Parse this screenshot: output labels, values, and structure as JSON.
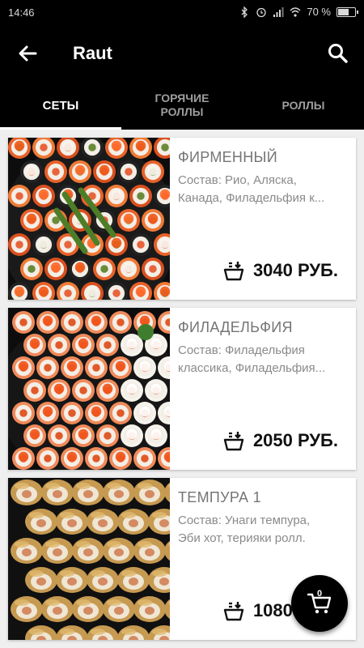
{
  "status_bar": {
    "time": "14:46",
    "battery": "70 %",
    "battery_level": 0.7,
    "icons": [
      "bluetooth-icon",
      "alarm-icon",
      "signal-icon",
      "wifi-icon",
      "battery-icon"
    ]
  },
  "toolbar": {
    "title": "Raut",
    "back_icon": "arrow-left-icon",
    "search_icon": "search-icon"
  },
  "tabs": [
    {
      "label": "СЕТЫ",
      "active": true
    },
    {
      "label": "ГОРЯЧИЕ\nРОЛЛЫ",
      "active": false
    },
    {
      "label": "РОЛЛЫ",
      "active": false
    }
  ],
  "products": [
    {
      "name": "ФИРМЕННЫЙ",
      "desc_line1": "Состав: Рио, Аляска,",
      "desc_line2": "Канада, Филадельфия к...",
      "price": "3040 РУБ."
    },
    {
      "name": "ФИЛАДЕЛЬФИЯ",
      "desc_line1": "Состав: Филадельфия",
      "desc_line2": "классика, Филадельфия...",
      "price": "2050 РУБ."
    },
    {
      "name": "ТЕМПУРА 1",
      "desc_line1": "Состав: Унаги темпура,",
      "desc_line2": "Эби хот, терияки ролл.",
      "price": "1080 РУБ."
    }
  ],
  "cart": {
    "count": "0",
    "icon": "cart-icon"
  },
  "colors": {
    "bar": "#000000",
    "accent": "#ffffff",
    "card": "#ffffff",
    "background": "#efefef"
  }
}
